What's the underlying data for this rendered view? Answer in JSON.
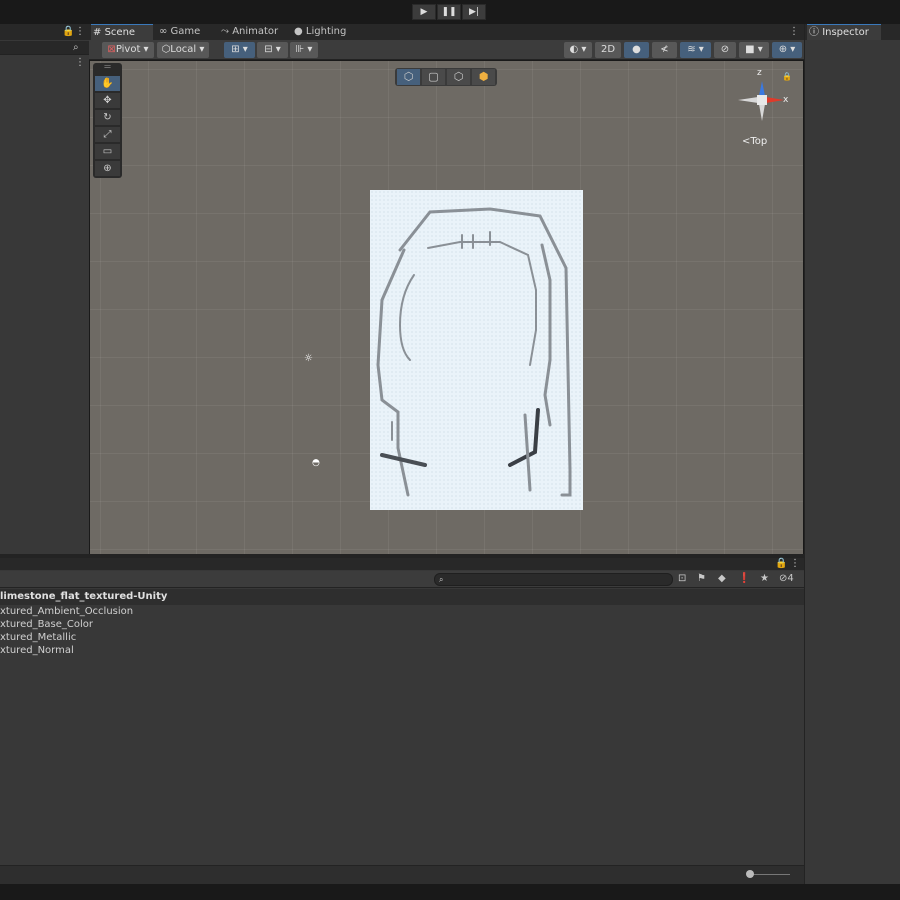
{
  "tabs": [
    {
      "label": "Scene",
      "icon": "grid-icon"
    },
    {
      "label": "Game",
      "icon": "gamepad-icon"
    },
    {
      "label": "Animator",
      "icon": "animator-icon"
    },
    {
      "label": "Lighting",
      "icon": "bulb-icon"
    }
  ],
  "toolbar": {
    "pivot_label": "Pivot",
    "local_label": "Local",
    "mode_2d_label": "2D"
  },
  "gizmo": {
    "view_label": "Top",
    "axis_z": "z",
    "axis_x": "x"
  },
  "inspector": {
    "tab_label": "Inspector"
  },
  "project": {
    "folder_name": "limestone_flat_textured-Unity",
    "files": [
      "xtured_Ambient_Occlusion",
      "xtured_Base_Color",
      "xtured_Metallic",
      "xtured_Normal"
    ],
    "hidden_count": "4"
  },
  "colors": {
    "accent": "#3a79bb",
    "viewport_bg": "#6e6a64",
    "panel_bg": "#383838",
    "paper": "#eaf3f9"
  }
}
